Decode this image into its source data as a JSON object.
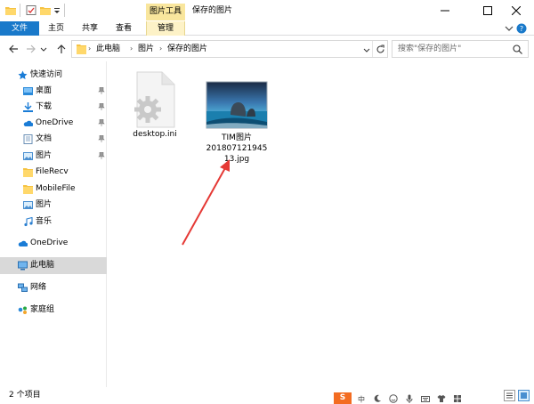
{
  "window": {
    "context_tab": "图片工具",
    "title": "保存的图片"
  },
  "ribbon": {
    "tabs": [
      "文件",
      "主页",
      "共享",
      "查看",
      "管理"
    ]
  },
  "address": {
    "segments": [
      "此电脑",
      "图片",
      "保存的图片"
    ]
  },
  "search": {
    "placeholder": "搜索\"保存的图片\""
  },
  "sidebar": {
    "items": [
      {
        "label": "快速访问"
      },
      {
        "label": "桌面"
      },
      {
        "label": "下载"
      },
      {
        "label": "OneDrive"
      },
      {
        "label": "文档"
      },
      {
        "label": "图片"
      },
      {
        "label": "FileRecv"
      },
      {
        "label": "MobileFile"
      },
      {
        "label": "图片"
      },
      {
        "label": "音乐"
      },
      {
        "label": "OneDrive"
      },
      {
        "label": "此电脑"
      },
      {
        "label": "网络"
      },
      {
        "label": "家庭组"
      }
    ]
  },
  "files": [
    {
      "name": "desktop.ini"
    },
    {
      "name_lines": [
        "TIM图片",
        "201807121945",
        "13.jpg"
      ]
    }
  ],
  "status": {
    "item_count": "2 个项目"
  },
  "colors": {
    "accent": "#1979ca",
    "picture_tools": "#f9e69d",
    "selected": "#d9d9d9",
    "arrow": "#e53935"
  }
}
